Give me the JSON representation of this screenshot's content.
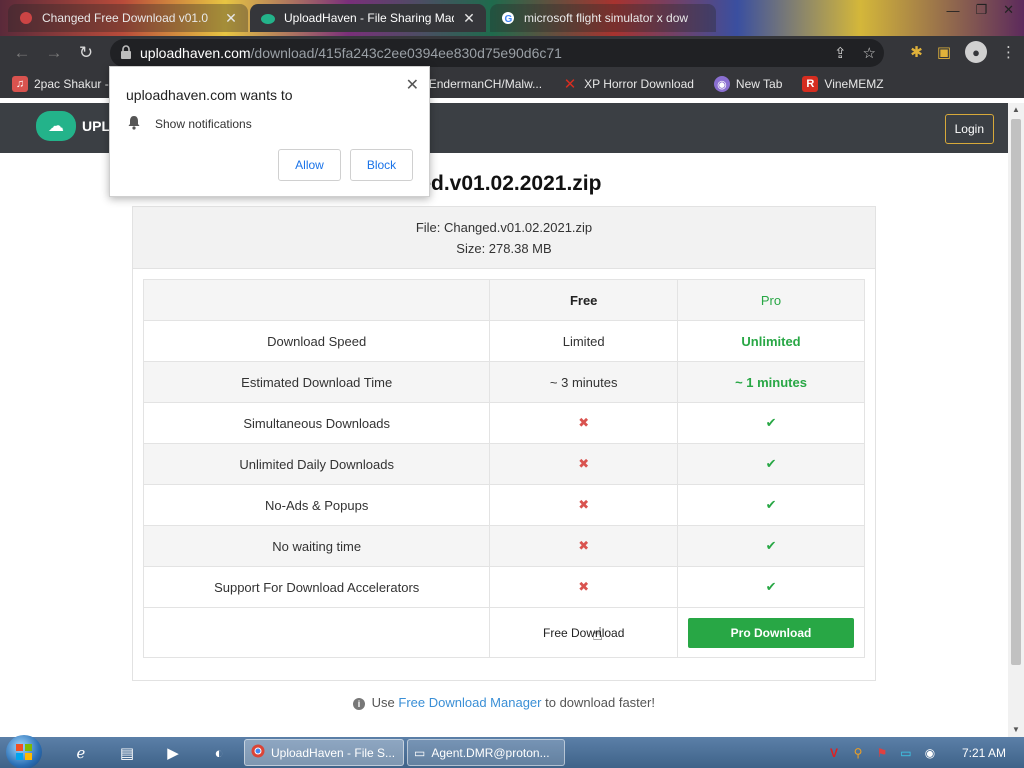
{
  "browser": {
    "tabs": [
      {
        "title": "Changed Free Download v01.0",
        "active": false
      },
      {
        "title": "UploadHaven - File Sharing Mad",
        "active": true
      },
      {
        "title": "microsoft flight simulator x dow",
        "active": false
      }
    ],
    "url_host": "uploadhaven.com",
    "url_path": "/download/415fa243c2ee0394ee830d75e90d6c71",
    "bookmarks": [
      {
        "label": "2pac Shakur -",
        "icon": "music-icon",
        "color": "#d9534f"
      },
      {
        "label": "EndermanCH/Malw...",
        "icon": "github-icon",
        "color": "#222222"
      },
      {
        "label": "XP Horror Download",
        "icon": "x-icon",
        "color": "#d62d20"
      },
      {
        "label": "New Tab",
        "icon": "globe-icon",
        "color": "#8a6fd1"
      },
      {
        "label": "VineMEMZ",
        "icon": "r-icon",
        "color": "#d62d20"
      }
    ]
  },
  "site": {
    "logo_text": "UPL",
    "login_label": "Login",
    "file_title": "ged.v01.02.2021.zip",
    "file_line": "File: Changed.v01.02.2021.zip",
    "size_line": "Size: 278.38 MB"
  },
  "comparison": {
    "headers": {
      "free": "Free",
      "pro": "Pro"
    },
    "rows": [
      {
        "feature": "Download Speed",
        "free": "Limited",
        "pro": "Unlimited",
        "type": "text"
      },
      {
        "feature": "Estimated Download Time",
        "free": "~ 3 minutes",
        "pro": "~ 1 minutes",
        "type": "text"
      },
      {
        "feature": "Simultaneous Downloads",
        "free": "✖",
        "pro": "✔",
        "type": "mark"
      },
      {
        "feature": "Unlimited Daily Downloads",
        "free": "✖",
        "pro": "✔",
        "type": "mark"
      },
      {
        "feature": "No-Ads & Popups",
        "free": "✖",
        "pro": "✔",
        "type": "mark"
      },
      {
        "feature": "No waiting time",
        "free": "✖",
        "pro": "✔",
        "type": "mark"
      },
      {
        "feature": "Support For Download Accelerators",
        "free": "✖",
        "pro": "✔",
        "type": "mark"
      }
    ],
    "free_download_label": "Free Download",
    "pro_download_label": "Pro Download"
  },
  "hint": {
    "prefix": "Use",
    "link": "Free Download Manager",
    "suffix": "to download faster!"
  },
  "permission_prompt": {
    "title": "uploadhaven.com wants to",
    "request": "Show notifications",
    "allow_label": "Allow",
    "block_label": "Block"
  },
  "taskbar": {
    "tasks": [
      {
        "label": "UploadHaven - File S...",
        "active": true
      },
      {
        "label": "Agent.DMR@proton...",
        "active": false
      }
    ],
    "clock": "7:21 AM"
  },
  "colors": {
    "green": "#28a745",
    "red": "#d9534f",
    "header_bg": "#3b3f44",
    "login_border": "#d7a93a"
  }
}
